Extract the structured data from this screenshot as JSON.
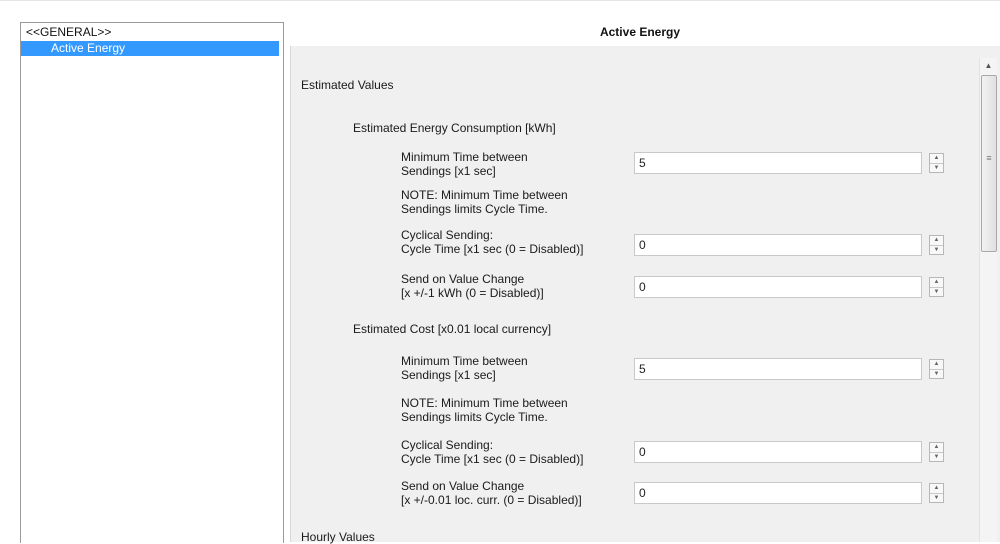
{
  "tree": {
    "root_label": "<<GENERAL>>",
    "selected_item": "Active Energy"
  },
  "panel": {
    "title": "Active Energy",
    "sections": {
      "estimated_values": "Estimated Values",
      "energy_consumption": "Estimated Energy Consumption [kWh]",
      "cost": "Estimated Cost [x0.01 local currency]",
      "hourly_values": "Hourly Values"
    },
    "energy": {
      "min_time_l1": "Minimum Time between",
      "min_time_l2": "Sendings [x1 sec]",
      "min_time_value": "5",
      "note_l1": "NOTE: Minimum Time between",
      "note_l2": "Sendings limits Cycle Time.",
      "cyclical_l1": "Cyclical Sending:",
      "cyclical_l2": "Cycle Time [x1 sec (0 = Disabled)]",
      "cyclical_value": "0",
      "change_l1": "Send on Value Change",
      "change_l2": "[x +/-1 kWh (0 = Disabled)]",
      "change_value": "0"
    },
    "cost": {
      "min_time_l1": "Minimum Time between",
      "min_time_l2": "Sendings [x1 sec]",
      "min_time_value": "5",
      "note_l1": "NOTE: Minimum Time between",
      "note_l2": "Sendings limits Cycle Time.",
      "cyclical_l1": "Cyclical Sending:",
      "cyclical_l2": "Cycle Time [x1 sec (0 = Disabled)]",
      "cyclical_value": "0",
      "change_l1": "Send on Value Change",
      "change_l2": "[x +/-0.01 loc. curr. (0 = Disabled)]",
      "change_value": "0"
    },
    "spinner": {
      "up": "▲",
      "down": "▼"
    },
    "scrollbar": {
      "up_arrow": "▲",
      "grip": "≡"
    }
  },
  "colors": {
    "selection": "#3399ff",
    "panel_bg": "#f0f0f0"
  }
}
